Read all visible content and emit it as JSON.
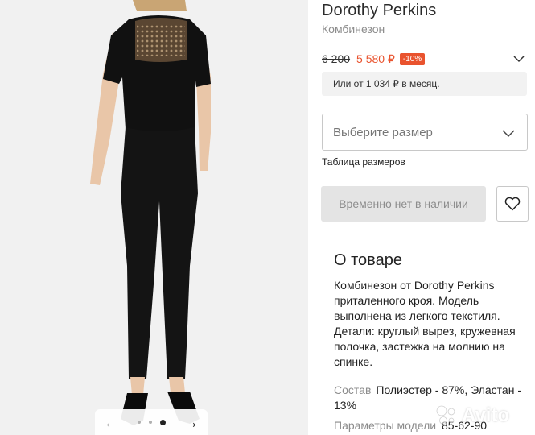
{
  "product": {
    "brand": "Dorothy Perkins",
    "type": "Комбинезон"
  },
  "price": {
    "old": "6 200",
    "new": "5 580 ₽",
    "discount": "-10%",
    "installment": "Или от 1 034 ₽ в месяц."
  },
  "size": {
    "placeholder": "Выберите размер",
    "table_link": "Таблица размеров"
  },
  "actions": {
    "out_of_stock": "Временно нет в наличии",
    "favorite_icon": "heart-icon"
  },
  "about": {
    "title": "О товаре",
    "description": "Комбинезон от Dorothy Perkins приталенного кроя. Модель выполнена из легкого текстиля. Детали: круглый вырез, кружевная полочка, застежка на молнию на спинке.",
    "composition_label": "Состав",
    "composition_value": "Полиэстер - 87%, Эластан - 13%",
    "params_label": "Параметры модели",
    "params_value": "85-62-90"
  },
  "gallery": {
    "prev_icon": "arrow-left-icon",
    "next_icon": "arrow-right-icon",
    "dots": 3,
    "active_dot": 2
  },
  "watermark": {
    "text": "Avito"
  },
  "colors": {
    "accent": "#e9532e",
    "muted": "#8c8c8c",
    "disabled_bg": "#e4e4e4"
  }
}
